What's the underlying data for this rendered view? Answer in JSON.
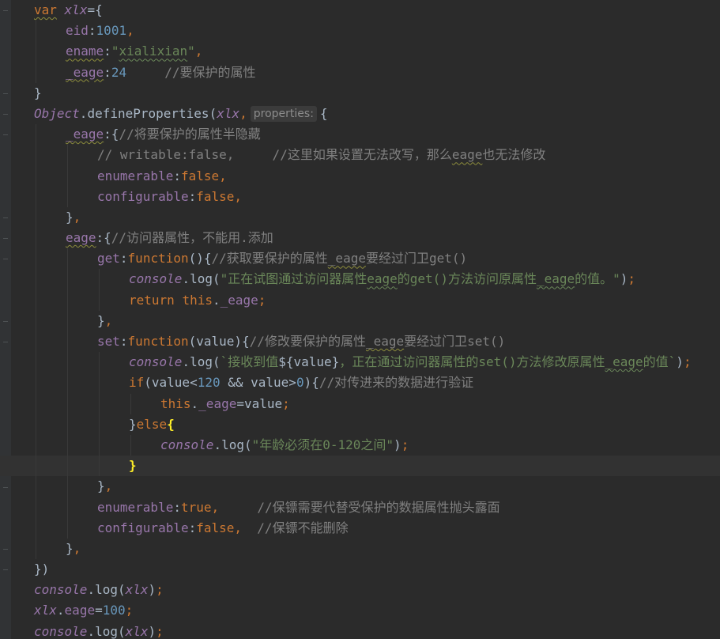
{
  "editor": {
    "theme_colors": {
      "background": "#2b2b2b",
      "keyword": "#cc7832",
      "property": "#9876aa",
      "number": "#6897bb",
      "string": "#6a8759",
      "comment": "#808080",
      "default": "#a9b7c6"
    },
    "lines": [
      {
        "indent": 1,
        "tokens": [
          [
            "kw squig-y",
            "var"
          ],
          [
            "plain",
            " "
          ],
          [
            "obj",
            "xlx"
          ],
          [
            "plain",
            "={"
          ]
        ]
      },
      {
        "indent": 2,
        "tokens": [
          [
            "prop",
            "eid"
          ],
          [
            "plain",
            ":"
          ],
          [
            "num",
            "1001"
          ],
          [
            "kw",
            ","
          ]
        ]
      },
      {
        "indent": 2,
        "tokens": [
          [
            "prop squig-y",
            "ename"
          ],
          [
            "plain",
            ":"
          ],
          [
            "str",
            "\""
          ],
          [
            "str squig",
            "xialixian"
          ],
          [
            "str",
            "\""
          ],
          [
            "kw",
            ","
          ]
        ]
      },
      {
        "indent": 2,
        "tokens": [
          [
            "prop squig-y",
            "_eage"
          ],
          [
            "plain",
            ":"
          ],
          [
            "num",
            "24"
          ],
          [
            "plain",
            "     "
          ],
          [
            "cmt",
            "//要保护的属性"
          ]
        ]
      },
      {
        "indent": 1,
        "tokens": [
          [
            "plain",
            "}"
          ]
        ]
      },
      {
        "indent": 1,
        "tokens": [
          [
            "obj",
            "Object"
          ],
          [
            "plain",
            "."
          ],
          [
            "plain",
            "defineProperties("
          ],
          [
            "obj",
            "xlx"
          ],
          [
            "kw",
            ","
          ],
          [
            "hint",
            "properties:"
          ],
          [
            "plain",
            "{"
          ]
        ]
      },
      {
        "indent": 2,
        "tokens": [
          [
            "prop squig-y",
            "_eage"
          ],
          [
            "plain",
            ":{"
          ],
          [
            "cmt",
            "//将要保护的属性半隐藏"
          ]
        ]
      },
      {
        "indent": 3,
        "tokens": [
          [
            "cmt",
            "// writable:false,     //这里如果设置无法改写，那么"
          ],
          [
            "cmt squig-y",
            "eage"
          ],
          [
            "cmt",
            "也无法修改"
          ]
        ]
      },
      {
        "indent": 3,
        "tokens": [
          [
            "prop",
            "enumerable"
          ],
          [
            "plain",
            ":"
          ],
          [
            "kw",
            "false,"
          ]
        ]
      },
      {
        "indent": 3,
        "tokens": [
          [
            "prop",
            "configurable"
          ],
          [
            "plain",
            ":"
          ],
          [
            "kw",
            "false,"
          ]
        ]
      },
      {
        "indent": 2,
        "tokens": [
          [
            "plain",
            "}"
          ],
          [
            "kw",
            ","
          ]
        ]
      },
      {
        "indent": 2,
        "tokens": [
          [
            "prop squig-y",
            "eage"
          ],
          [
            "plain",
            ":{"
          ],
          [
            "cmt",
            "//访问器属性，不能用.添加"
          ]
        ]
      },
      {
        "indent": 3,
        "tokens": [
          [
            "prop",
            "get"
          ],
          [
            "plain",
            ":"
          ],
          [
            "kw",
            "function"
          ],
          [
            "plain",
            "(){"
          ],
          [
            "cmt",
            "//获取要保护的属性"
          ],
          [
            "cmt squig-y",
            "_eage"
          ],
          [
            "cmt",
            "要经过门卫get()"
          ]
        ]
      },
      {
        "indent": 4,
        "tokens": [
          [
            "obj",
            "console"
          ],
          [
            "plain",
            "."
          ],
          [
            "plain",
            "log("
          ],
          [
            "str",
            "\"正在试图通过访问器属性"
          ],
          [
            "str squig",
            "eage"
          ],
          [
            "str",
            "的get()方法访问原属性"
          ],
          [
            "str squig",
            "_eage"
          ],
          [
            "str",
            "的值。\""
          ],
          [
            "plain",
            ")"
          ],
          [
            "kw",
            ";"
          ]
        ]
      },
      {
        "indent": 4,
        "tokens": [
          [
            "kw",
            "return "
          ],
          [
            "kw",
            "this"
          ],
          [
            "plain",
            "."
          ],
          [
            "prop",
            "_eage"
          ],
          [
            "kw",
            ";"
          ]
        ]
      },
      {
        "indent": 3,
        "tokens": [
          [
            "plain",
            "}"
          ],
          [
            "kw",
            ","
          ]
        ]
      },
      {
        "indent": 3,
        "tokens": [
          [
            "prop",
            "set"
          ],
          [
            "plain",
            ":"
          ],
          [
            "kw",
            "function"
          ],
          [
            "plain",
            "(value){"
          ],
          [
            "cmt",
            "//修改要保护的属性"
          ],
          [
            "cmt squig-y",
            "_eage"
          ],
          [
            "cmt",
            "要经过门卫set()"
          ]
        ]
      },
      {
        "indent": 4,
        "tokens": [
          [
            "obj",
            "console"
          ],
          [
            "plain",
            "."
          ],
          [
            "plain",
            "log("
          ],
          [
            "str",
            "`接收到值"
          ],
          [
            "plain",
            "${value}"
          ],
          [
            "str",
            "，正在通过访问器属性的set()方法修改原属性"
          ],
          [
            "str squig",
            "_eage"
          ],
          [
            "str",
            "的值`"
          ],
          [
            "plain",
            ")"
          ],
          [
            "kw",
            ";"
          ]
        ]
      },
      {
        "indent": 4,
        "tokens": [
          [
            "kw",
            "if"
          ],
          [
            "plain",
            "(value<"
          ],
          [
            "num",
            "120"
          ],
          [
            "plain",
            " && value>"
          ],
          [
            "num",
            "0"
          ],
          [
            "plain",
            "){"
          ],
          [
            "cmt",
            "//对传进来的数据进行验证"
          ]
        ]
      },
      {
        "indent": 5,
        "tokens": [
          [
            "kw",
            "this"
          ],
          [
            "plain",
            "."
          ],
          [
            "prop",
            "_eage"
          ],
          [
            "plain",
            "=value"
          ],
          [
            "kw",
            ";"
          ]
        ]
      },
      {
        "indent": 4,
        "tokens": [
          [
            "plain",
            "}"
          ],
          [
            "kw",
            "else"
          ],
          [
            "brace-hl",
            "{"
          ]
        ]
      },
      {
        "indent": 5,
        "tokens": [
          [
            "obj",
            "console"
          ],
          [
            "plain",
            "."
          ],
          [
            "plain",
            "log("
          ],
          [
            "str",
            "\"年龄必须在0-120之间\""
          ],
          [
            "plain",
            ")"
          ],
          [
            "kw",
            ";"
          ]
        ]
      },
      {
        "indent": 4,
        "current": true,
        "tokens": [
          [
            "brace-hl",
            "}"
          ]
        ]
      },
      {
        "indent": 3,
        "tokens": [
          [
            "plain",
            "}"
          ],
          [
            "kw",
            ","
          ]
        ]
      },
      {
        "indent": 3,
        "tokens": [
          [
            "prop",
            "enumerable"
          ],
          [
            "plain",
            ":"
          ],
          [
            "kw",
            "true,"
          ],
          [
            "plain",
            "     "
          ],
          [
            "cmt",
            "//保镖需要代替受保护的数据属性抛头露面"
          ]
        ]
      },
      {
        "indent": 3,
        "tokens": [
          [
            "prop",
            "configurable"
          ],
          [
            "plain",
            ":"
          ],
          [
            "kw",
            "false,"
          ],
          [
            "plain",
            "  "
          ],
          [
            "cmt",
            "//保镖不能删除"
          ]
        ]
      },
      {
        "indent": 2,
        "tokens": [
          [
            "plain",
            "}"
          ],
          [
            "kw",
            ","
          ]
        ]
      },
      {
        "indent": 1,
        "tokens": [
          [
            "plain",
            "})"
          ]
        ]
      },
      {
        "indent": 1,
        "tokens": [
          [
            "obj",
            "console"
          ],
          [
            "plain",
            "."
          ],
          [
            "plain",
            "log("
          ],
          [
            "obj",
            "xlx"
          ],
          [
            "plain",
            ")"
          ],
          [
            "kw",
            ";"
          ]
        ]
      },
      {
        "indent": 1,
        "tokens": [
          [
            "obj",
            "xlx"
          ],
          [
            "plain",
            "."
          ],
          [
            "prop",
            "eage"
          ],
          [
            "plain",
            "="
          ],
          [
            "num",
            "100"
          ],
          [
            "kw",
            ";"
          ]
        ]
      },
      {
        "indent": 1,
        "tokens": [
          [
            "obj",
            "console"
          ],
          [
            "plain",
            "."
          ],
          [
            "plain",
            "log("
          ],
          [
            "obj",
            "xlx"
          ],
          [
            "plain",
            ")"
          ],
          [
            "kw",
            ";"
          ]
        ]
      }
    ]
  }
}
